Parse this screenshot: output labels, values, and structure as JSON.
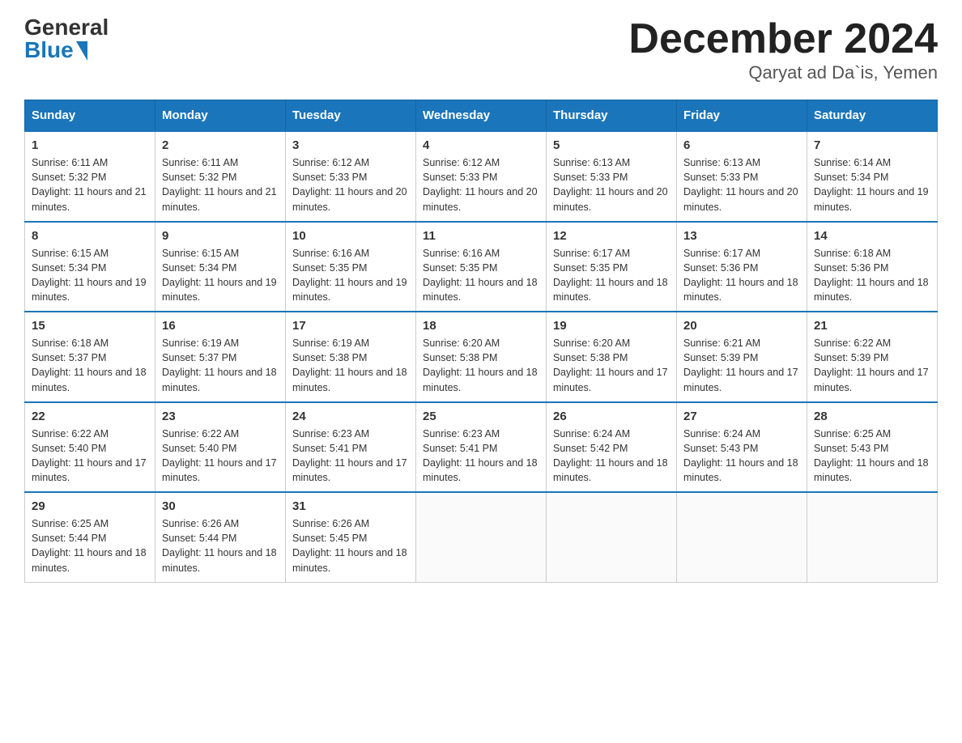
{
  "logo": {
    "general": "General",
    "blue": "Blue"
  },
  "title": "December 2024",
  "location": "Qaryat ad Da`is, Yemen",
  "days_header": [
    "Sunday",
    "Monday",
    "Tuesday",
    "Wednesday",
    "Thursday",
    "Friday",
    "Saturday"
  ],
  "weeks": [
    [
      {
        "day": "1",
        "sunrise": "6:11 AM",
        "sunset": "5:32 PM",
        "daylight": "11 hours and 21 minutes."
      },
      {
        "day": "2",
        "sunrise": "6:11 AM",
        "sunset": "5:32 PM",
        "daylight": "11 hours and 21 minutes."
      },
      {
        "day": "3",
        "sunrise": "6:12 AM",
        "sunset": "5:33 PM",
        "daylight": "11 hours and 20 minutes."
      },
      {
        "day": "4",
        "sunrise": "6:12 AM",
        "sunset": "5:33 PM",
        "daylight": "11 hours and 20 minutes."
      },
      {
        "day": "5",
        "sunrise": "6:13 AM",
        "sunset": "5:33 PM",
        "daylight": "11 hours and 20 minutes."
      },
      {
        "day": "6",
        "sunrise": "6:13 AM",
        "sunset": "5:33 PM",
        "daylight": "11 hours and 20 minutes."
      },
      {
        "day": "7",
        "sunrise": "6:14 AM",
        "sunset": "5:34 PM",
        "daylight": "11 hours and 19 minutes."
      }
    ],
    [
      {
        "day": "8",
        "sunrise": "6:15 AM",
        "sunset": "5:34 PM",
        "daylight": "11 hours and 19 minutes."
      },
      {
        "day": "9",
        "sunrise": "6:15 AM",
        "sunset": "5:34 PM",
        "daylight": "11 hours and 19 minutes."
      },
      {
        "day": "10",
        "sunrise": "6:16 AM",
        "sunset": "5:35 PM",
        "daylight": "11 hours and 19 minutes."
      },
      {
        "day": "11",
        "sunrise": "6:16 AM",
        "sunset": "5:35 PM",
        "daylight": "11 hours and 18 minutes."
      },
      {
        "day": "12",
        "sunrise": "6:17 AM",
        "sunset": "5:35 PM",
        "daylight": "11 hours and 18 minutes."
      },
      {
        "day": "13",
        "sunrise": "6:17 AM",
        "sunset": "5:36 PM",
        "daylight": "11 hours and 18 minutes."
      },
      {
        "day": "14",
        "sunrise": "6:18 AM",
        "sunset": "5:36 PM",
        "daylight": "11 hours and 18 minutes."
      }
    ],
    [
      {
        "day": "15",
        "sunrise": "6:18 AM",
        "sunset": "5:37 PM",
        "daylight": "11 hours and 18 minutes."
      },
      {
        "day": "16",
        "sunrise": "6:19 AM",
        "sunset": "5:37 PM",
        "daylight": "11 hours and 18 minutes."
      },
      {
        "day": "17",
        "sunrise": "6:19 AM",
        "sunset": "5:38 PM",
        "daylight": "11 hours and 18 minutes."
      },
      {
        "day": "18",
        "sunrise": "6:20 AM",
        "sunset": "5:38 PM",
        "daylight": "11 hours and 18 minutes."
      },
      {
        "day": "19",
        "sunrise": "6:20 AM",
        "sunset": "5:38 PM",
        "daylight": "11 hours and 17 minutes."
      },
      {
        "day": "20",
        "sunrise": "6:21 AM",
        "sunset": "5:39 PM",
        "daylight": "11 hours and 17 minutes."
      },
      {
        "day": "21",
        "sunrise": "6:22 AM",
        "sunset": "5:39 PM",
        "daylight": "11 hours and 17 minutes."
      }
    ],
    [
      {
        "day": "22",
        "sunrise": "6:22 AM",
        "sunset": "5:40 PM",
        "daylight": "11 hours and 17 minutes."
      },
      {
        "day": "23",
        "sunrise": "6:22 AM",
        "sunset": "5:40 PM",
        "daylight": "11 hours and 17 minutes."
      },
      {
        "day": "24",
        "sunrise": "6:23 AM",
        "sunset": "5:41 PM",
        "daylight": "11 hours and 17 minutes."
      },
      {
        "day": "25",
        "sunrise": "6:23 AM",
        "sunset": "5:41 PM",
        "daylight": "11 hours and 18 minutes."
      },
      {
        "day": "26",
        "sunrise": "6:24 AM",
        "sunset": "5:42 PM",
        "daylight": "11 hours and 18 minutes."
      },
      {
        "day": "27",
        "sunrise": "6:24 AM",
        "sunset": "5:43 PM",
        "daylight": "11 hours and 18 minutes."
      },
      {
        "day": "28",
        "sunrise": "6:25 AM",
        "sunset": "5:43 PM",
        "daylight": "11 hours and 18 minutes."
      }
    ],
    [
      {
        "day": "29",
        "sunrise": "6:25 AM",
        "sunset": "5:44 PM",
        "daylight": "11 hours and 18 minutes."
      },
      {
        "day": "30",
        "sunrise": "6:26 AM",
        "sunset": "5:44 PM",
        "daylight": "11 hours and 18 minutes."
      },
      {
        "day": "31",
        "sunrise": "6:26 AM",
        "sunset": "5:45 PM",
        "daylight": "11 hours and 18 minutes."
      },
      null,
      null,
      null,
      null
    ]
  ]
}
